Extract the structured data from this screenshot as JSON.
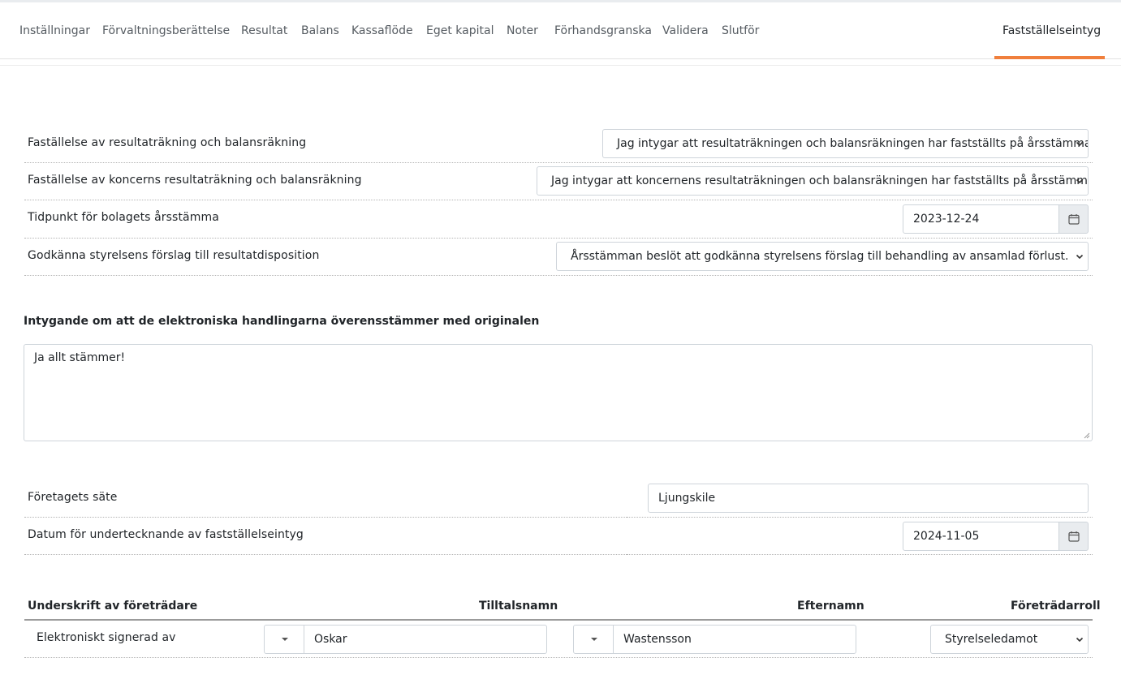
{
  "nav": {
    "tabs": [
      {
        "label": "Inställningar"
      },
      {
        "label": "Förvaltningsberättelse"
      },
      {
        "label": "Resultat"
      },
      {
        "label": "Balans"
      },
      {
        "label": "Kassaflöde"
      },
      {
        "label": "Eget kapital"
      },
      {
        "label": "Noter"
      },
      {
        "label": "Förhandsgranska"
      },
      {
        "label": "Validera"
      },
      {
        "label": "Slutför"
      },
      {
        "label": "Fastställelseintyg",
        "active": true
      }
    ],
    "accent_color": "#f07f3c"
  },
  "form": {
    "rows": [
      {
        "label": "Faställelse av resultaträkning och balansräkning",
        "value": "Jag intygar att resultaträkningen och balansräkningen har fastställts på årsstämma"
      },
      {
        "label": "Faställelse av koncerns resultaträkning och balansräkning",
        "value": "Jag intygar att koncernens resultaträkningen och balansräkningen har fastställts på årsstämma"
      },
      {
        "label": "Tidpunkt för bolagets årsstämma",
        "value": "2023-12-24"
      },
      {
        "label": "Godkänna styrelsens förslag till resultatdisposition",
        "value": "Årsstämman beslöt att godkänna styrelsens förslag till behandling av ansamlad förlust."
      }
    ]
  },
  "certification": {
    "title": "Intygande om att de elektroniska handlingarna överensstämmer med originalen",
    "text": "Ja allt stämmer!"
  },
  "company": {
    "seat_label": "Företagets säte",
    "seat_value": "Ljungskile",
    "sign_date_label": "Datum för undertecknande av fastställelseintyg",
    "sign_date_value": "2024-11-05"
  },
  "signatures": {
    "headers": {
      "signature": "Underskrift av företrädare",
      "first_name": "Tilltalsnamn",
      "last_name": "Efternamn",
      "role": "Företrädarroll"
    },
    "rows": [
      {
        "label": "Elektroniskt signerad av",
        "first_name": "Oskar",
        "last_name": "Wastensson",
        "role": "Styrelseledamot"
      }
    ]
  }
}
